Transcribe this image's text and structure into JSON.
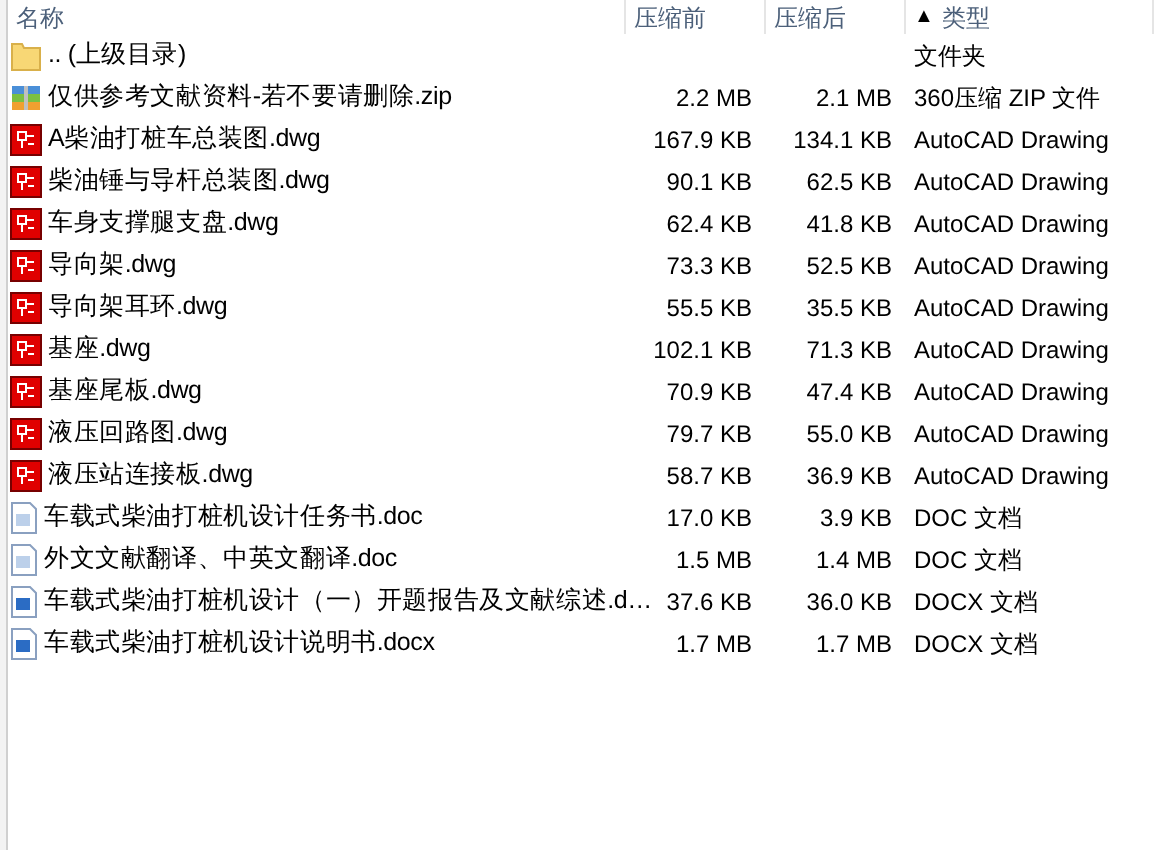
{
  "columns": [
    {
      "label": "名称"
    },
    {
      "label": "压缩前"
    },
    {
      "label": "压缩后"
    },
    {
      "label": "类型",
      "sort_indicator": "▲"
    }
  ],
  "rows": [
    {
      "kind": "folder",
      "name": ".. (上级目录)",
      "type": "文件夹"
    },
    {
      "kind": "zip",
      "name": "仅供参考文献资料-若不要请删除.zip",
      "size_before": "2.2 MB",
      "size_after": "2.1 MB",
      "type": "360压缩 ZIP 文件"
    },
    {
      "kind": "dwg",
      "name": "A柴油打桩车总装图.dwg",
      "size_before": "167.9 KB",
      "size_after": "134.1 KB",
      "type": "AutoCAD Drawing"
    },
    {
      "kind": "dwg",
      "name": "柴油锤与导杆总装图.dwg",
      "size_before": "90.1 KB",
      "size_after": "62.5 KB",
      "type": "AutoCAD Drawing"
    },
    {
      "kind": "dwg",
      "name": "车身支撑腿支盘.dwg",
      "size_before": "62.4 KB",
      "size_after": "41.8 KB",
      "type": "AutoCAD Drawing"
    },
    {
      "kind": "dwg",
      "name": "导向架.dwg",
      "size_before": "73.3 KB",
      "size_after": "52.5 KB",
      "type": "AutoCAD Drawing"
    },
    {
      "kind": "dwg",
      "name": "导向架耳环.dwg",
      "size_before": "55.5 KB",
      "size_after": "35.5 KB",
      "type": "AutoCAD Drawing"
    },
    {
      "kind": "dwg",
      "name": "基座.dwg",
      "size_before": "102.1 KB",
      "size_after": "71.3 KB",
      "type": "AutoCAD Drawing"
    },
    {
      "kind": "dwg",
      "name": "基座尾板.dwg",
      "size_before": "70.9 KB",
      "size_after": "47.4 KB",
      "type": "AutoCAD Drawing"
    },
    {
      "kind": "dwg",
      "name": "液压回路图.dwg",
      "size_before": "79.7 KB",
      "size_after": "55.0 KB",
      "type": "AutoCAD Drawing"
    },
    {
      "kind": "dwg",
      "name": "液压站连接板.dwg",
      "size_before": "58.7 KB",
      "size_after": "36.9 KB",
      "type": "AutoCAD Drawing"
    },
    {
      "kind": "doc",
      "name": "车载式柴油打桩机设计任务书.doc",
      "size_before": "17.0 KB",
      "size_after": "3.9 KB",
      "type": "DOC 文档"
    },
    {
      "kind": "doc",
      "name": "外文文献翻译、中英文翻译.doc",
      "size_before": "1.5 MB",
      "size_after": "1.4 MB",
      "type": "DOC 文档"
    },
    {
      "kind": "docx",
      "name": "车载式柴油打桩机设计（一）开题报告及文献综述.d…",
      "size_before": "37.6 KB",
      "size_after": "36.0 KB",
      "type": "DOCX 文档"
    },
    {
      "kind": "docx",
      "name": "车载式柴油打桩机设计说明书.docx",
      "size_before": "1.7 MB",
      "size_after": "1.7 MB",
      "type": "DOCX 文档"
    }
  ]
}
